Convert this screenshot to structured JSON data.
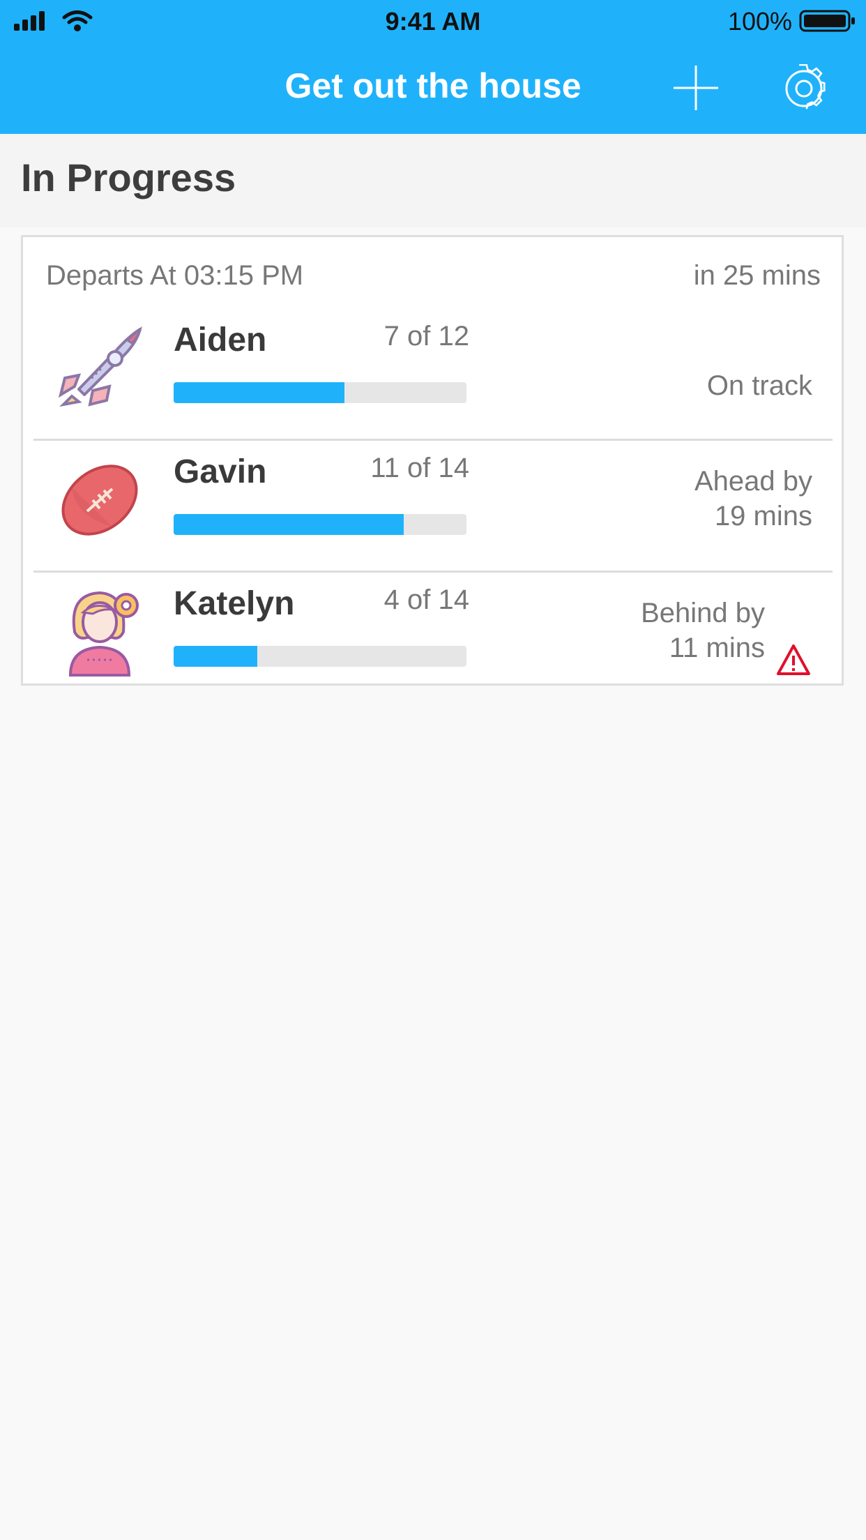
{
  "status_bar": {
    "time": "9:41 AM",
    "battery": "100%",
    "icons": [
      "signal-icon",
      "wifi-icon",
      "battery-icon"
    ]
  },
  "nav": {
    "title": "Get out the house",
    "add_icon": "plus-icon",
    "settings_icon": "gear-icon"
  },
  "section": {
    "title": "In Progress"
  },
  "trip": {
    "departs": "Departs At 03:15 PM",
    "relative": "in 25 mins"
  },
  "kids": [
    {
      "name": "Aiden",
      "count": "7 of 12",
      "done": 7,
      "total": 12,
      "status_line1": "On track",
      "status_line2": "",
      "avatar": "rocket-icon",
      "warning": false
    },
    {
      "name": "Gavin",
      "count": "11 of 14",
      "done": 11,
      "total": 14,
      "status_line1": "Ahead by",
      "status_line2": "19 mins",
      "avatar": "football-icon",
      "warning": false
    },
    {
      "name": "Katelyn",
      "count": "4 of 14",
      "done": 4,
      "total": 14,
      "status_line1": "Behind by",
      "status_line2": "11 mins",
      "avatar": "girl-avatar-icon",
      "warning": true
    }
  ],
  "colors": {
    "accent": "#1fb2fb",
    "warning": "#e0102c",
    "track": "#e6e6e6"
  }
}
